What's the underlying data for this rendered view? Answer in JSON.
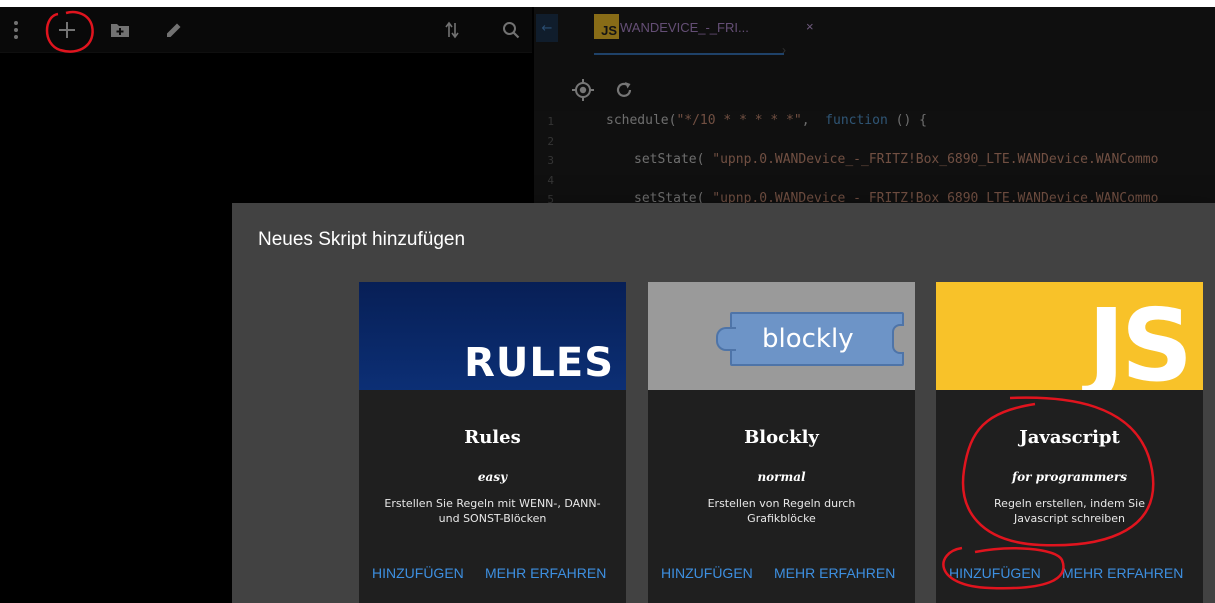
{
  "left_toolbar": {
    "icons": [
      "more-vertical-icon",
      "plus-icon",
      "new-folder-icon",
      "edit-pencil-icon",
      "sort-icon",
      "search-icon"
    ]
  },
  "editor": {
    "tab": {
      "badge": "JS",
      "title": "WANDEVICE_-_FRI...",
      "close": "×"
    },
    "toolbar_icons": [
      "target-icon",
      "refresh-icon"
    ],
    "code_lines": [
      {
        "n": "1",
        "parts": [
          {
            "t": "schedule(",
            "c": ""
          },
          {
            "t": "\"*/10 * * * * *\"",
            "c": "str"
          },
          {
            "t": ",  ",
            "c": ""
          },
          {
            "t": "function",
            "c": "kw"
          },
          {
            "t": " () {",
            "c": ""
          }
        ]
      },
      {
        "n": "2",
        "parts": []
      },
      {
        "n": "3",
        "parts": [
          {
            "t": "setState( ",
            "c": ""
          },
          {
            "t": "\"upnp.0.WANDevice_-_FRITZ!Box_6890_LTE.WANDevice.WANCommo",
            "c": "str"
          }
        ]
      },
      {
        "n": "4",
        "parts": []
      },
      {
        "n": "5",
        "parts": [
          {
            "t": "setState( ",
            "c": ""
          },
          {
            "t": "\"upnp.0.WANDevice_-_FRITZ!Box_6890_LTE.WANDevice.WANCommo",
            "c": "str"
          }
        ]
      }
    ]
  },
  "dialog": {
    "title": "Neues Skript hinzufügen",
    "cards": [
      {
        "banner_text": "RULES",
        "name": "Rules",
        "level": "easy",
        "description": "Erstellen Sie Regeln mit WENN-, DANN- und SONST-Blöcken",
        "add_label": "HINZUFÜGEN",
        "more_label": "MEHR ERFAHREN"
      },
      {
        "banner_text": "blockly",
        "name": "Blockly",
        "level": "normal",
        "description": "Erstellen von Regeln durch Grafikblöcke",
        "add_label": "HINZUFÜGEN",
        "more_label": "MEHR ERFAHREN"
      },
      {
        "banner_text": "JS",
        "name": "Javascript",
        "level": "for programmers",
        "description": "Regeln erstellen, indem Sie Javascript schreiben",
        "add_label": "HINZUFÜGEN",
        "more_label": "MEHR ERFAHREN"
      }
    ]
  },
  "colors": {
    "accent_blue": "#3d8fe0",
    "annotation_red": "#e0141e",
    "js_yellow": "#f8c229",
    "rules_navy": "#0c2a6b",
    "dialog_bg": "#424242",
    "card_bg": "#1f1f1f"
  }
}
